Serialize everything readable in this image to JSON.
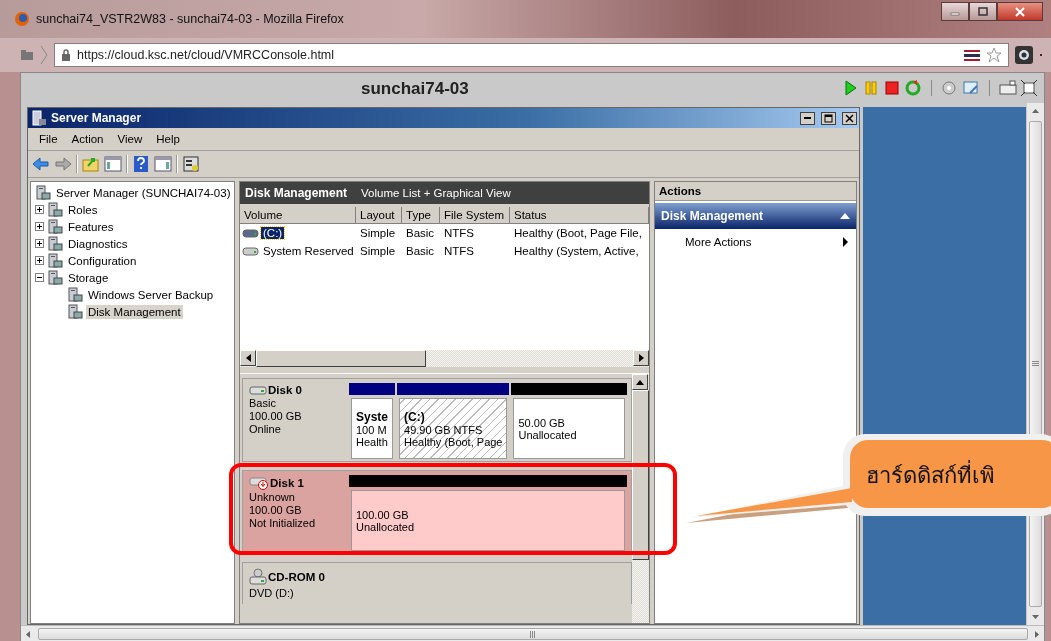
{
  "browser": {
    "title": "sunchai74_VSTR2W83 - sunchai74-03 - Mozilla Firefox",
    "url": "https://cloud.ksc.net/cloud/VMRCConsole.html"
  },
  "console": {
    "title": "sunchai74-03"
  },
  "server_manager": {
    "title": "Server Manager",
    "menu": [
      "File",
      "Action",
      "View",
      "Help"
    ],
    "tree": {
      "label": "Server Manager (SUNCHAI74-03)",
      "selected": false,
      "children": [
        {
          "label": "Roles",
          "expanded": false,
          "selected": false
        },
        {
          "label": "Features",
          "expanded": false,
          "selected": false
        },
        {
          "label": "Diagnostics",
          "expanded": false,
          "selected": false
        },
        {
          "label": "Configuration",
          "expanded": false,
          "selected": false
        },
        {
          "label": "Storage",
          "expanded": true,
          "selected": false,
          "children": [
            {
              "label": "Windows Server Backup",
              "selected": false
            },
            {
              "label": "Disk Management",
              "selected": true
            }
          ]
        }
      ]
    }
  },
  "disk_management": {
    "title": "Disk Management",
    "view": "Volume List + Graphical View",
    "columns": [
      "Volume",
      "Layout",
      "Type",
      "File System",
      "Status"
    ],
    "volumes": [
      {
        "cells": [
          "(C:)",
          "Simple",
          "Basic",
          "NTFS",
          "Healthy (Boot, Page File,"
        ],
        "selected": true
      },
      {
        "cells": [
          "System Reserved",
          "Simple",
          "Basic",
          "NTFS",
          "Healthy (System, Active,"
        ],
        "selected": false
      }
    ],
    "disks": [
      {
        "kind": "disk",
        "name": "Disk 0",
        "lines": [
          "Basic",
          "100.00 GB",
          "Online"
        ],
        "highlighted": false,
        "partitions": [
          {
            "kind": "primary",
            "title": "Syste",
            "lines": [
              "100 M",
              "Health"
            ],
            "selected": false
          },
          {
            "kind": "primary",
            "title": "(C:)",
            "lines": [
              "49.90 GB NTFS",
              "Healthy (Boot, Page"
            ],
            "selected": true
          },
          {
            "kind": "unallocated",
            "lines": [
              "50.00 GB",
              "Unallocated"
            ],
            "selected": false
          }
        ]
      },
      {
        "kind": "disk-error",
        "name": "Disk 1",
        "lines": [
          "Unknown",
          "100.00 GB",
          "Not Initialized"
        ],
        "highlighted": true,
        "partitions": [
          {
            "kind": "unallocated",
            "lines": [
              "100.00 GB",
              "Unallocated"
            ],
            "selected": false
          }
        ]
      },
      {
        "kind": "cdrom",
        "name": "CD-ROM 0",
        "lines": [
          "DVD (D:)"
        ],
        "highlighted": false
      }
    ]
  },
  "actions": {
    "title": "Actions",
    "section": "Disk Management",
    "items": [
      "More Actions"
    ]
  },
  "callout": {
    "text": "ฮาร์ดดิสก์ที่เพิ"
  }
}
